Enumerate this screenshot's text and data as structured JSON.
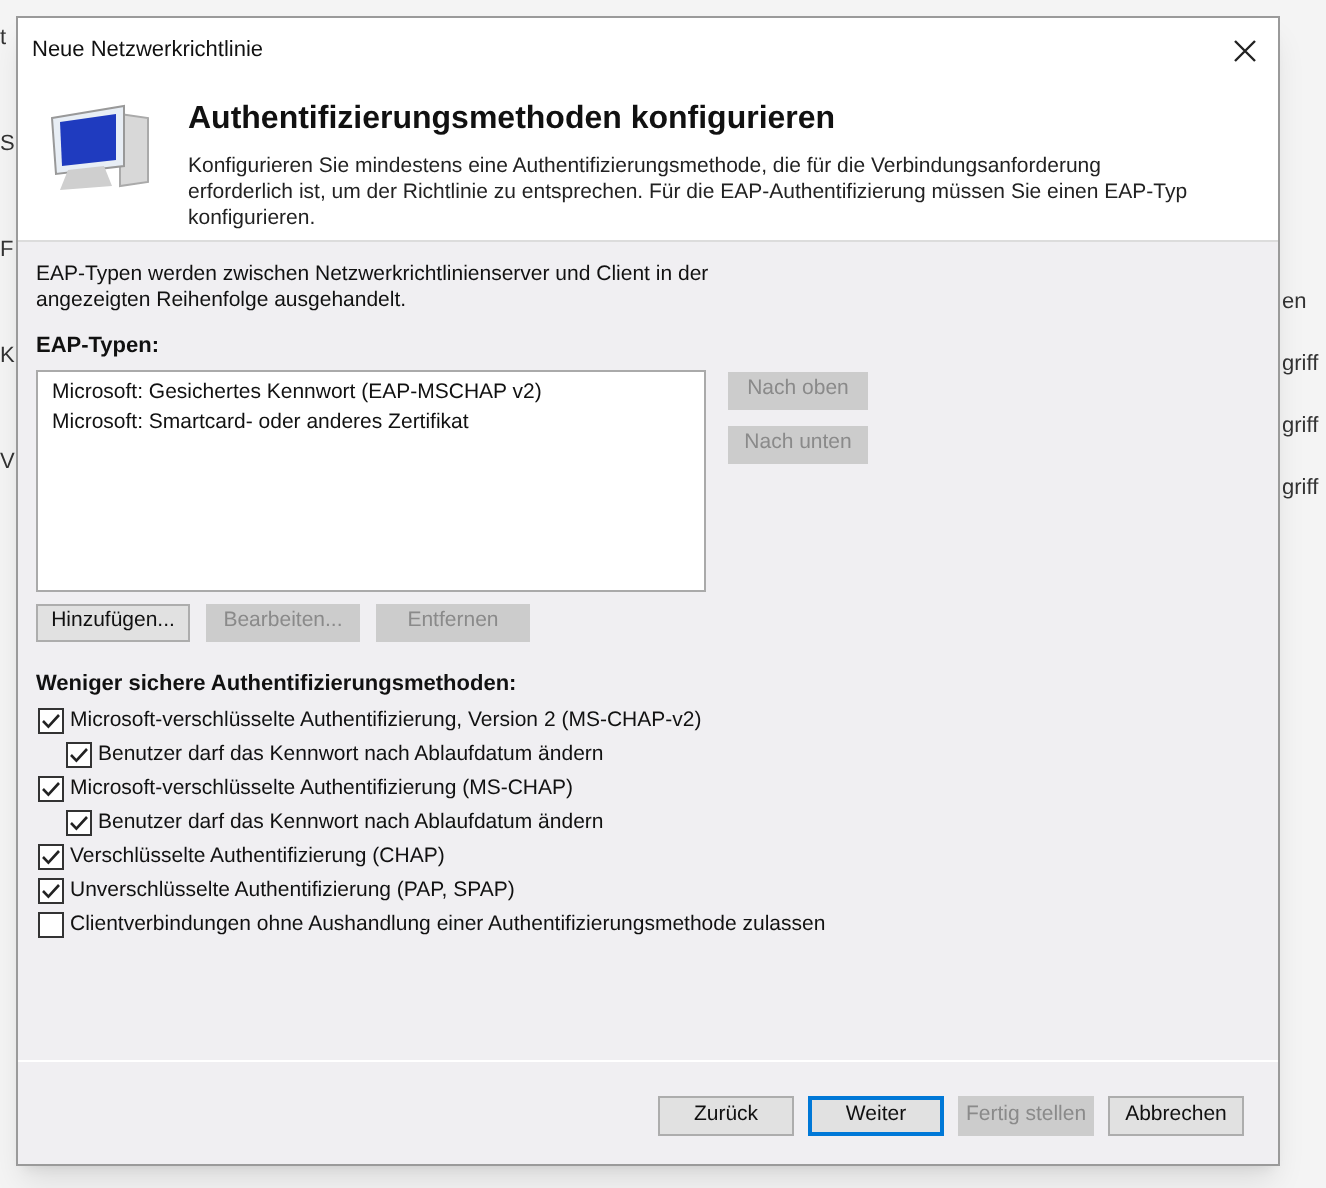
{
  "background_fragments": {
    "left": [
      "t",
      "S",
      "F",
      "K",
      "V"
    ],
    "right": [
      "en",
      "griff",
      "griff",
      "griff"
    ]
  },
  "window": {
    "title": "Neue Netzwerkrichtlinie"
  },
  "header": {
    "title": "Authentifizierungsmethoden konfigurieren",
    "description": "Konfigurieren Sie mindestens eine Authentifizierungsmethode, die für die Verbindungsanforderung erforderlich ist, um der Richtlinie zu entsprechen. Für die EAP-Authentifizierung müssen Sie einen EAP-Typ konfigurieren."
  },
  "intro": "EAP-Typen werden zwischen Netzwerkrichtlinienserver und Client in der angezeigten Reihenfolge ausgehandelt.",
  "eap_types": {
    "label": "EAP-Typen:",
    "items": [
      "Microsoft: Gesichertes Kennwort (EAP-MSCHAP v2)",
      "Microsoft: Smartcard- oder anderes Zertifikat"
    ],
    "side_buttons": [
      {
        "label": "Nach oben",
        "disabled": true
      },
      {
        "label": "Nach unten",
        "disabled": true
      }
    ],
    "buttons": [
      {
        "label": "Hinzufügen...",
        "disabled": false
      },
      {
        "label": "Bearbeiten...",
        "disabled": true
      },
      {
        "label": "Entfernen",
        "disabled": true
      }
    ]
  },
  "less_secure": {
    "label": "Weniger sichere Authentifizierungsmethoden:",
    "options": [
      {
        "label": "Microsoft-verschlüsselte Authentifizierung, Version 2 (MS-CHAP-v2)",
        "checked": true,
        "children": [
          {
            "label": "Benutzer darf das Kennwort nach Ablaufdatum ändern",
            "checked": true
          }
        ]
      },
      {
        "label": "Microsoft-verschlüsselte Authentifizierung (MS-CHAP)",
        "checked": true,
        "children": [
          {
            "label": "Benutzer darf das Kennwort nach Ablaufdatum ändern",
            "checked": true
          }
        ]
      },
      {
        "label": "Verschlüsselte Authentifizierung (CHAP)",
        "checked": true
      },
      {
        "label": "Unverschlüsselte Authentifizierung (PAP, SPAP)",
        "checked": true
      },
      {
        "label": "Clientverbindungen ohne Aushandlung einer Authentifizierungsmethode zulassen",
        "checked": false
      }
    ]
  },
  "footer_buttons": [
    {
      "label": "Zurück",
      "disabled": false,
      "default": false
    },
    {
      "label": "Weiter",
      "disabled": false,
      "default": true
    },
    {
      "label": "Fertig stellen",
      "disabled": true,
      "default": false
    },
    {
      "label": "Abbrechen",
      "disabled": false,
      "default": false
    }
  ]
}
